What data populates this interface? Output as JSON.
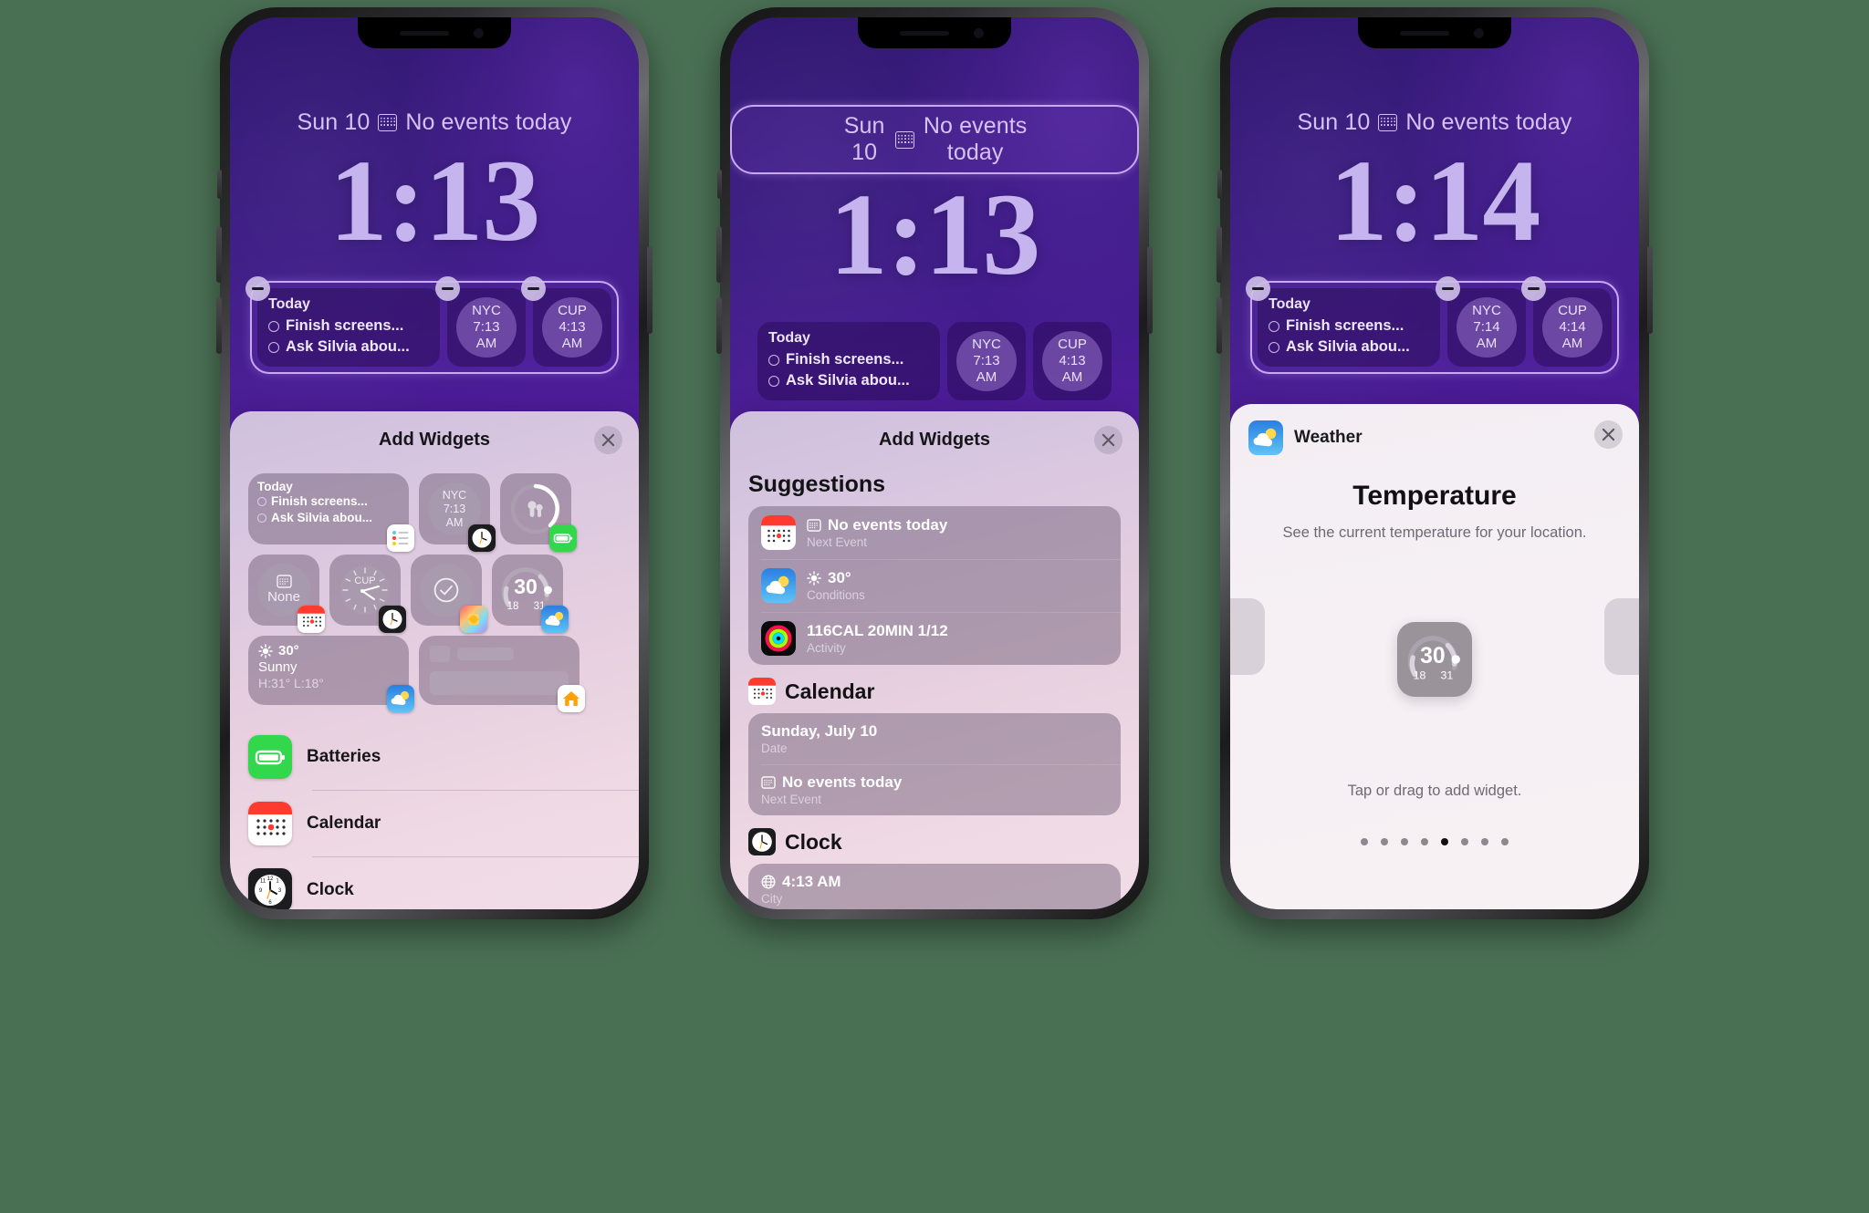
{
  "meta": {
    "accent_purple": "#6b22b4",
    "highlight_border": "#c9a8f7",
    "sheet_pink": "#e6cfdf",
    "background_green": "#4a7054"
  },
  "phones": [
    {
      "id": "phone-1",
      "lock": {
        "date": "Sun 10",
        "calendar_icon": "calendar-glyph-icon",
        "event_status": "No events today",
        "date_selected": false,
        "time": "1:13",
        "tray_selected": true,
        "widgets": {
          "today": {
            "title": "Today",
            "items": [
              "Finish screens...",
              "Ask Silvia abou..."
            ]
          },
          "clocks": [
            {
              "city": "NYC",
              "time": "7:13",
              "meridiem": "AM"
            },
            {
              "city": "CUP",
              "time": "4:13",
              "meridiem": "AM"
            }
          ]
        }
      },
      "sheet": {
        "kind": "gallery",
        "title": "Add Widgets",
        "close_icon": "close-icon",
        "gallery": [
          [
            {
              "type": "today",
              "title": "Today",
              "items": [
                "Finish screens...",
                "Ask Silvia abou..."
              ],
              "badge": "reminders-icon",
              "size": "wide"
            },
            {
              "type": "clock-digital",
              "city": "NYC",
              "time": "7:13",
              "meridiem": "AM",
              "badge": "clock-icon",
              "size": "sq"
            },
            {
              "type": "airpods-battery",
              "badge": "batteries-icon",
              "size": "sq"
            }
          ],
          [
            {
              "type": "calendar-none",
              "label": "None",
              "badge": "calendar-icon",
              "size": "sq"
            },
            {
              "type": "clock-analog",
              "city": "CUP",
              "badge": "clock-icon",
              "size": "sq"
            },
            {
              "type": "shortcut-check",
              "badge": "shortcuts-icon",
              "size": "sq"
            },
            {
              "type": "temperature-gauge",
              "current": "30",
              "low": "18",
              "high": "31",
              "badge": "weather-icon",
              "size": "sq"
            }
          ],
          [
            {
              "type": "weather-summary",
              "temp": "30°",
              "condition": "Sunny",
              "range": "H:31° L:18°",
              "badge": "weather-icon",
              "size": "med"
            },
            {
              "type": "placeholder",
              "badge": "home-icon",
              "size": "med"
            }
          ]
        ],
        "apps": [
          {
            "name": "Batteries",
            "icon": "batteries-icon"
          },
          {
            "name": "Calendar",
            "icon": "calendar-icon"
          },
          {
            "name": "Clock",
            "icon": "clock-icon"
          }
        ]
      }
    },
    {
      "id": "phone-2",
      "lock": {
        "date": "Sun 10",
        "calendar_icon": "calendar-glyph-icon",
        "event_status": "No events today",
        "date_selected": true,
        "time": "1:13",
        "tray_selected": false,
        "widgets": {
          "today": {
            "title": "Today",
            "items": [
              "Finish screens...",
              "Ask Silvia abou..."
            ]
          },
          "clocks": [
            {
              "city": "NYC",
              "time": "7:13",
              "meridiem": "AM"
            },
            {
              "city": "CUP",
              "time": "4:13",
              "meridiem": "AM"
            }
          ]
        }
      },
      "sheet": {
        "kind": "suggestions",
        "title": "Add Widgets",
        "close_icon": "close-icon",
        "sections": [
          {
            "heading": "Suggestions",
            "heading_icon": null,
            "rows": [
              {
                "icon": "calendar-icon",
                "primary": "No events today",
                "primary_glyph": "calendar-glyph-icon",
                "secondary": "Next Event"
              },
              {
                "icon": "weather-icon",
                "primary": "30°",
                "primary_glyph": "sun-icon",
                "secondary": "Conditions"
              },
              {
                "icon": "activity-icon",
                "primary": "116CAL 20MIN 1/12",
                "primary_glyph": null,
                "secondary": "Activity"
              }
            ]
          },
          {
            "heading": "Calendar",
            "heading_icon": "calendar-icon",
            "rows": [
              {
                "icon": null,
                "primary": "Sunday, July 10",
                "primary_glyph": null,
                "secondary": "Date"
              },
              {
                "icon": null,
                "primary": "No events today",
                "primary_glyph": "calendar-glyph-icon",
                "secondary": "Next Event"
              }
            ]
          },
          {
            "heading": "Clock",
            "heading_icon": "clock-icon",
            "rows": [
              {
                "icon": null,
                "primary": "4:13 AM",
                "primary_glyph": "globe-icon",
                "secondary": "City"
              }
            ]
          }
        ]
      }
    },
    {
      "id": "phone-3",
      "lock": {
        "date": "Sun 10",
        "calendar_icon": "calendar-glyph-icon",
        "event_status": "No events today",
        "date_selected": false,
        "time": "1:14",
        "tray_selected": true,
        "widgets": {
          "today": {
            "title": "Today",
            "items": [
              "Finish screens...",
              "Ask Silvia abou..."
            ]
          },
          "clocks": [
            {
              "city": "NYC",
              "time": "7:14",
              "meridiem": "AM"
            },
            {
              "city": "CUP",
              "time": "4:14",
              "meridiem": "AM"
            }
          ]
        }
      },
      "sheet": {
        "kind": "detail",
        "app_name": "Weather",
        "app_icon": "weather-icon",
        "close_icon": "close-icon",
        "widget_title": "Temperature",
        "widget_description": "See the current temperature for your location.",
        "preview": {
          "current": "30",
          "low": "18",
          "high": "31"
        },
        "hint": "Tap or drag to add widget.",
        "page_count": 8,
        "page_active_index": 4
      }
    }
  ]
}
